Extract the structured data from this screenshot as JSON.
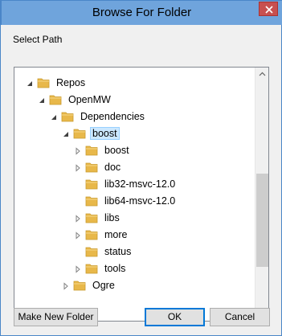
{
  "window": {
    "title": "Browse For Folder"
  },
  "dialog": {
    "prompt": "Select Path"
  },
  "tree": {
    "items": [
      {
        "label": "Repos",
        "expanded": true,
        "has_children": true,
        "selected": false
      },
      {
        "label": "OpenMW",
        "expanded": true,
        "has_children": true,
        "selected": false
      },
      {
        "label": "Dependencies",
        "expanded": true,
        "has_children": true,
        "selected": false
      },
      {
        "label": "boost",
        "expanded": true,
        "has_children": true,
        "selected": true
      },
      {
        "label": "boost",
        "expanded": false,
        "has_children": true,
        "selected": false
      },
      {
        "label": "doc",
        "expanded": false,
        "has_children": true,
        "selected": false
      },
      {
        "label": "lib32-msvc-12.0",
        "expanded": false,
        "has_children": false,
        "selected": false
      },
      {
        "label": "lib64-msvc-12.0",
        "expanded": false,
        "has_children": false,
        "selected": false
      },
      {
        "label": "libs",
        "expanded": false,
        "has_children": true,
        "selected": false
      },
      {
        "label": "more",
        "expanded": false,
        "has_children": true,
        "selected": false
      },
      {
        "label": "status",
        "expanded": false,
        "has_children": false,
        "selected": false
      },
      {
        "label": "tools",
        "expanded": false,
        "has_children": true,
        "selected": false
      },
      {
        "label": "Ogre",
        "expanded": false,
        "has_children": true,
        "selected": false
      }
    ]
  },
  "buttons": {
    "make_new_folder": "Make New Folder",
    "ok": "OK",
    "cancel": "Cancel"
  },
  "colors": {
    "titlebar": "#6fa4dc",
    "selection": "#cce8ff",
    "close": "#c75050",
    "folder": "#e8b84a"
  },
  "icons": [
    "close-icon",
    "folder-icon",
    "expand-arrow-icon",
    "collapse-arrow-icon",
    "scroll-up-icon",
    "scroll-down-icon"
  ]
}
